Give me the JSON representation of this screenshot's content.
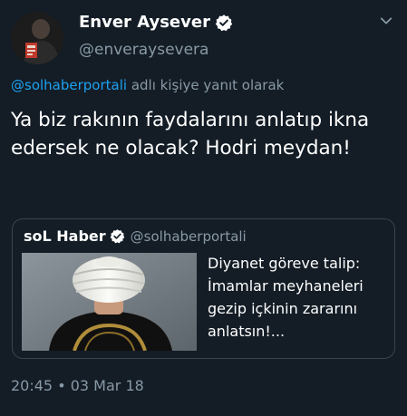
{
  "author": {
    "name": "Enver Aysever",
    "handle": "@enveraysevera",
    "verified": true
  },
  "reply": {
    "mention": "@solhaberportali",
    "suffix": "adlı kişiye yanıt olarak"
  },
  "tweet": {
    "text": "Ya biz rakının faydalarını anlatıp ikna edersek ne olacak? Hodri meydan!"
  },
  "quote": {
    "name": "soL Haber",
    "handle": "@solhaberportali",
    "verified": true,
    "text": "Diyanet göreve talip: İmamlar meyhaneleri gezip içkinin zararını anlatsın!..."
  },
  "meta": {
    "timestamp": "20:45 • 03 Mar 18"
  },
  "colors": {
    "background": "#141d26",
    "primary_text": "#ffffff",
    "secondary_text": "#8899a6",
    "accent": "#1da1f2",
    "border": "#38444d"
  },
  "icons": {
    "verified": "verified-badge-icon",
    "menu": "chevron-down-icon"
  }
}
